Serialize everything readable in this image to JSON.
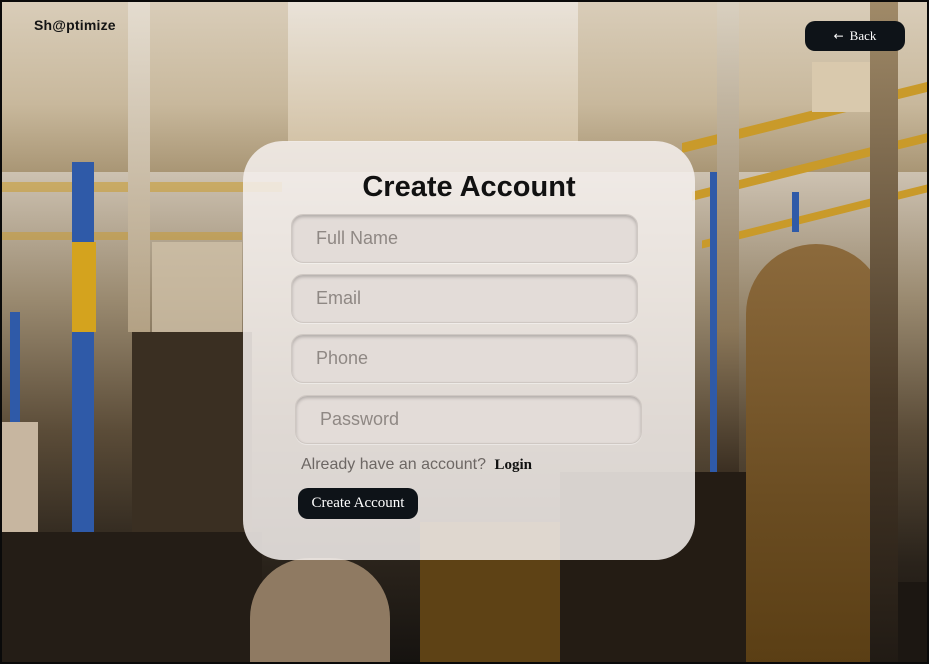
{
  "header": {
    "logo_text": "Sh@ptimize",
    "back_label": "Back",
    "back_icon": "arrow-left-icon"
  },
  "form": {
    "title": "Create Account",
    "fields": {
      "full_name_placeholder": "Full Name",
      "email_placeholder": "Email",
      "phone_placeholder": "Phone",
      "password_placeholder": "Password"
    },
    "login_prompt": "Already have an account?",
    "login_link": "Login",
    "submit_label": "Create Account"
  },
  "colors": {
    "button_bg": "#0e1318",
    "card_bg": "#f5f0ee",
    "field_bg": "#e3dcd8"
  }
}
